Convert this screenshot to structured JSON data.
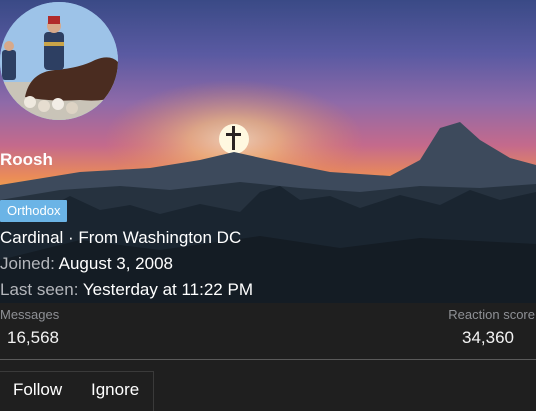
{
  "profile": {
    "username": "Roosh",
    "badge": "Orthodox",
    "title_location": "Cardinal · From Washington DC",
    "joined_label": "Joined:",
    "joined_value": "August 3, 2008",
    "last_seen_label": "Last seen:",
    "last_seen_value": "Yesterday at 11:22 PM"
  },
  "stats": {
    "messages_label": "Messages",
    "messages_value": "16,568",
    "reaction_label": "Reaction score",
    "reaction_value": "34,360"
  },
  "actions": {
    "follow_label": "Follow",
    "ignore_label": "Ignore"
  },
  "colors": {
    "badge_bg": "#6bb4e6",
    "page_bg": "#1f1f1f"
  },
  "icons": {
    "banner_cross": "cross-icon"
  }
}
